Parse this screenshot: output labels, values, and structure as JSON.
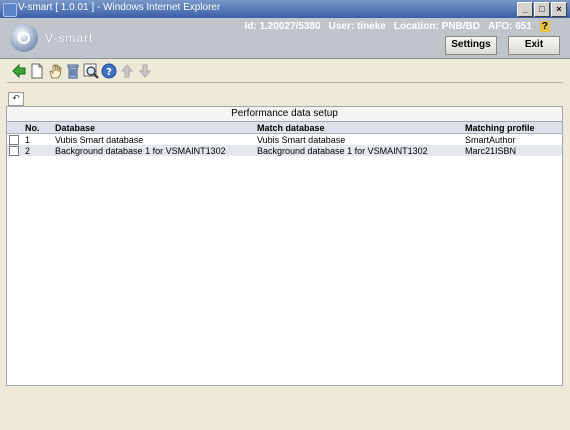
{
  "window": {
    "title": "V-smart [ 1.0.01 ] - Windows Internet Explorer",
    "controls": [
      "_",
      "□",
      "×"
    ]
  },
  "header": {
    "brand": "V-smart",
    "id_text": "Id: 1.20027/5380",
    "user_text": "User: tineke",
    "location_text": "Location: PNB/BD",
    "afo_text": "AFO: 651",
    "help_glyph": "?",
    "settings_label": "Settings",
    "exit_label": "Exit"
  },
  "toolbar": {
    "icons": [
      "back-arrow-icon",
      "new-document-icon",
      "hand-select-icon",
      "trash-icon",
      "search-icon",
      "help-icon",
      "up-arrow-icon",
      "down-arrow-icon"
    ],
    "undo_glyph": "↶"
  },
  "panel": {
    "title": "Performance data setup",
    "columns": [
      "No.",
      "Database",
      "Match database",
      "Matching profile"
    ],
    "rows": [
      {
        "no": "1",
        "database": "Vubis Smart database",
        "match_database": "Vubis Smart database",
        "profile": "SmartAuthor"
      },
      {
        "no": "2",
        "database": "Background database 1 for VSMAINT1302",
        "match_database": "Background database 1 for VSMAINT1302",
        "profile": "Marc21ISBN"
      }
    ]
  },
  "colors": {
    "titlebar": "#3a5fa8",
    "header": "#c0c4cb",
    "row_alt": "#e4e8ee"
  }
}
